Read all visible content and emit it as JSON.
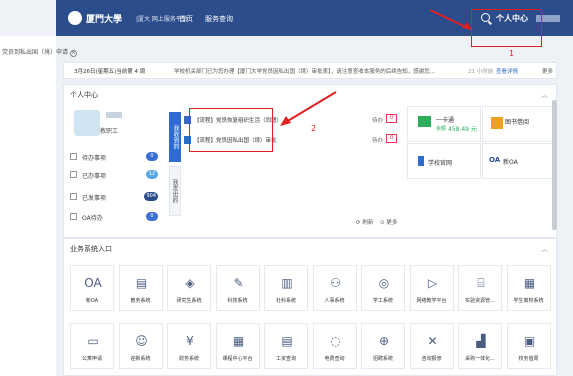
{
  "header": {
    "logo_text": "厦門大學",
    "site_name": "|厦大 网上服务平台",
    "nav": [
      "首页",
      "服务查询"
    ],
    "personal_center": "个人中心"
  },
  "annotations": {
    "callout_1": "1",
    "callout_2": "2"
  },
  "breadcrumb": {
    "label": "党员到私出国（境）申请",
    "close": "×"
  },
  "notice": {
    "date": "3月26日(星期五)当前第 4 周",
    "text": "学校机关部门已为您办理【厦门大学党员因私出国（境）审批表】，请注意查收本服务的后续告知，感谢您...",
    "time": "21 小时前",
    "view_detail": "查看详情",
    "more": "更多"
  },
  "personal_center": {
    "title": "个人中心",
    "role": "教职工",
    "stats": [
      {
        "label": "待办事项",
        "count": "0",
        "color": "#3a6fd1"
      },
      {
        "label": "已办事项",
        "count": "12",
        "color": "#5aa6e8"
      },
      {
        "label": "已发事项",
        "count": "904",
        "color": "#2b4d8c"
      },
      {
        "label": "OA待办",
        "count": "0",
        "color": "#3a6fd1"
      }
    ],
    "tabs": [
      "我收到的",
      "我发出的"
    ],
    "tasks": [
      {
        "title": "【流程】党员恢复组织生活（同籍）...",
        "status": "待办",
        "count": "0"
      },
      {
        "title": "【流程】党员因私出国（境）审批",
        "status": "待办",
        "count": "0"
      }
    ],
    "refresh": "刷新",
    "more": "更多",
    "tiles": [
      {
        "title": "一卡通",
        "sub": "余额",
        "value": "458.49 元",
        "color": "#2cae5a"
      },
      {
        "title": "图书借阅",
        "color": "#f0a020"
      },
      {
        "title": "学校官网",
        "color": "#2f6ccf"
      },
      {
        "title": "新OA",
        "color": "#2b4d8c"
      }
    ]
  },
  "business": {
    "title": "业务系统入口",
    "apps": [
      {
        "label": "新OA",
        "icon": "OA"
      },
      {
        "label": "教务系统",
        "icon": "▤"
      },
      {
        "label": "研究生系统",
        "icon": "◈"
      },
      {
        "label": "科技系统",
        "icon": "✎"
      },
      {
        "label": "社科系统",
        "icon": "▥"
      },
      {
        "label": "人事系统",
        "icon": "⚇"
      },
      {
        "label": "学工系统",
        "icon": "◎"
      },
      {
        "label": "网络教学平台",
        "icon": "▷"
      },
      {
        "label": "实验资源管...",
        "icon": "⌸"
      },
      {
        "label": "学生离校系统",
        "icon": "▦"
      },
      {
        "label": "公寓申请",
        "icon": "▭"
      },
      {
        "label": "迎新系统",
        "icon": "☺"
      },
      {
        "label": "财务系统",
        "icon": "¥"
      },
      {
        "label": "课程中心平台",
        "icon": "▦"
      },
      {
        "label": "工资查询",
        "icon": "▤"
      },
      {
        "label": "电费查询",
        "icon": "◌"
      },
      {
        "label": "招聘系统",
        "icon": "⊕"
      },
      {
        "label": "咨询报修",
        "icon": "✕"
      },
      {
        "label": "采购一体化...",
        "icon": "▟"
      },
      {
        "label": "校务值周",
        "icon": "▣"
      }
    ]
  }
}
